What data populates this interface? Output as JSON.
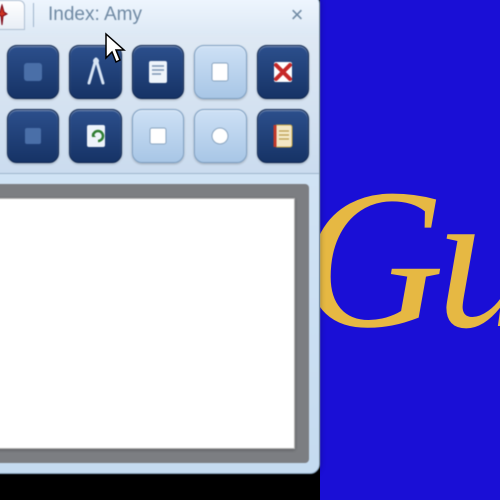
{
  "window": {
    "title": "Index: Amy",
    "close_label": "×"
  },
  "script_text": "Gui",
  "toolbar": {
    "row1": [
      {
        "name": "tool-1",
        "style": "dark"
      },
      {
        "name": "compass-icon",
        "style": "dark"
      },
      {
        "name": "document-icon",
        "style": "dark"
      },
      {
        "name": "page-icon",
        "style": "light"
      },
      {
        "name": "delete-icon",
        "style": "dark"
      }
    ],
    "row2": [
      {
        "name": "tool-6",
        "style": "dark"
      },
      {
        "name": "refresh-doc-icon",
        "style": "dark"
      },
      {
        "name": "tool-8",
        "style": "light"
      },
      {
        "name": "tool-9",
        "style": "light"
      },
      {
        "name": "notes-icon",
        "style": "dark"
      }
    ]
  },
  "icons": {
    "pin": "pin-icon"
  }
}
